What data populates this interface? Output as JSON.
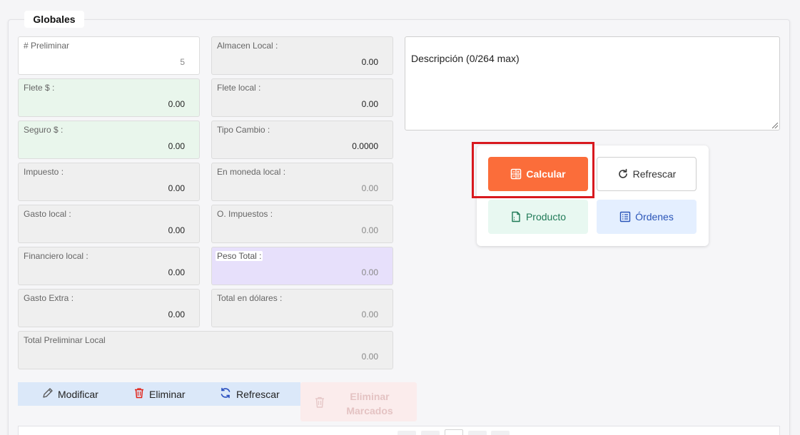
{
  "section_title": "Globales",
  "fields_left": [
    {
      "label": "# Preliminar",
      "value": "5"
    },
    {
      "label": "Flete $ :",
      "value": "0.00"
    },
    {
      "label": "Seguro $ :",
      "value": "0.00"
    },
    {
      "label": "Impuesto :",
      "value": "0.00"
    },
    {
      "label": "Gasto local :",
      "value": "0.00"
    },
    {
      "label": "Financiero local :",
      "value": "0.00"
    },
    {
      "label": "Gasto Extra :",
      "value": "0.00"
    }
  ],
  "fields_right": [
    {
      "label": "Almacen Local :",
      "value": "0.00"
    },
    {
      "label": "Flete local :",
      "value": "0.00"
    },
    {
      "label": "Tipo Cambio :",
      "value": "0.0000"
    },
    {
      "label": "En moneda local :",
      "value": "0.00"
    },
    {
      "label": "O. Impuestos :",
      "value": "0.00"
    },
    {
      "label": "Peso Total :",
      "value": "0.00"
    },
    {
      "label": "Total en dólares :",
      "value": "0.00"
    }
  ],
  "total_preliminar": {
    "label": "Total Preliminar Local",
    "value": "0.00"
  },
  "description": {
    "placeholder": "Descripción (0/264 max)"
  },
  "actions": {
    "calcular": "Calcular",
    "refrescar": "Refrescar",
    "producto": "Producto",
    "ordenes": "Órdenes"
  },
  "toolbar": {
    "modificar": "Modificar",
    "eliminar": "Eliminar",
    "refrescar": "Refrescar",
    "eliminar_marcados_1": "Eliminar",
    "eliminar_marcados_2": "Marcados"
  },
  "colors": {
    "accent": "#fb6d3a",
    "highlight": "#d8191f",
    "green_field": "#e9f6ec",
    "purple_field": "#e7e0fb"
  }
}
